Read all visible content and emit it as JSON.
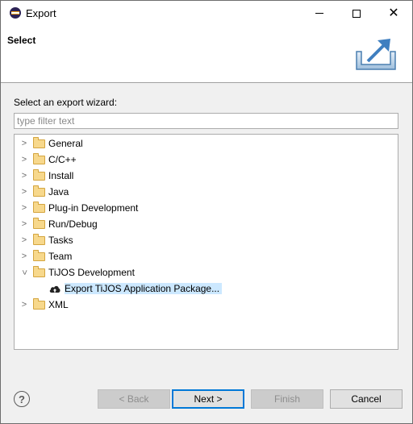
{
  "window": {
    "title": "Export"
  },
  "header": {
    "title": "Select"
  },
  "filter": {
    "label": "Select an export wizard:",
    "placeholder": "type filter text",
    "value": ""
  },
  "tree": {
    "items": [
      {
        "label": "General",
        "expanded": false
      },
      {
        "label": "C/C++",
        "expanded": false
      },
      {
        "label": "Install",
        "expanded": false
      },
      {
        "label": "Java",
        "expanded": false
      },
      {
        "label": "Plug-in Development",
        "expanded": false
      },
      {
        "label": "Run/Debug",
        "expanded": false
      },
      {
        "label": "Tasks",
        "expanded": false
      },
      {
        "label": "Team",
        "expanded": false
      },
      {
        "label": "TiJOS Development",
        "expanded": true
      },
      {
        "label": "Export TiJOS Application Package...",
        "child": true,
        "selected": true
      },
      {
        "label": "XML",
        "expanded": false
      }
    ]
  },
  "buttons": {
    "back": "< Back",
    "next": "Next >",
    "finish": "Finish",
    "cancel": "Cancel"
  },
  "colors": {
    "selection": "#cce8ff",
    "default_button_border": "#0078d7",
    "folder": "#f7d88c"
  }
}
